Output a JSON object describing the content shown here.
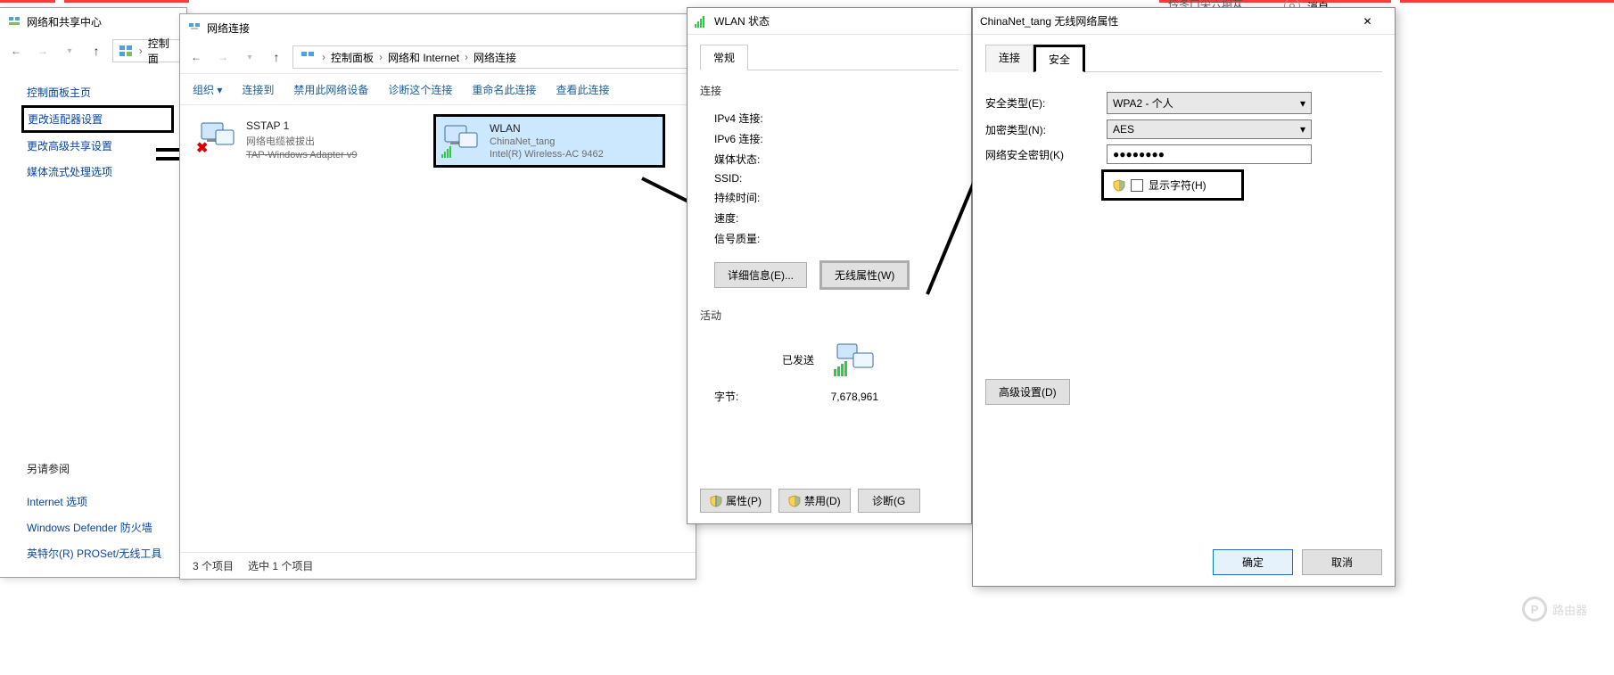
{
  "top_bar": {
    "msg_fragment_left": "—",
    "msg_fragment_right": "消自",
    "partial_text": "仱冬口尖六坰苁"
  },
  "win1": {
    "title": "网络和共享中心",
    "breadcrumb1": "控制面",
    "sidebar": {
      "home": "控制面板主页",
      "adapter": "更改适配器设置",
      "advanced": "更改高级共享设置",
      "media": "媒体流式处理选项",
      "see_also": "另请参阅",
      "internet_options": "Internet 选项",
      "defender": "Windows Defender 防火墙",
      "intel": "英特尔(R) PROSet/无线工具"
    }
  },
  "win2": {
    "title": "网络连接",
    "breadcrumb": [
      "控制面板",
      "网络和 Internet",
      "网络连接"
    ],
    "cmds": {
      "org": "组织",
      "connect": "连接到",
      "disable": "禁用此网络设备",
      "diagnose": "诊断这个连接",
      "rename": "重命名此连接",
      "view": "查看此连接"
    },
    "items": {
      "sstap": {
        "name": "SSTAP 1",
        "line2": "网络电缆被拔出",
        "line3": "TAP-Windows Adapter v9"
      },
      "wlan": {
        "name": "WLAN",
        "line2": "ChinaNet_tang",
        "line3": "Intel(R) Wireless-AC 9462"
      }
    },
    "status_left": "3 个项目",
    "status_right": "选中 1 个项目"
  },
  "wlan_status": {
    "title": "WLAN 状态",
    "tab_general": "常规",
    "section_connection": "连接",
    "rows": {
      "ipv4": "IPv4 连接:",
      "ipv6": "IPv6 连接:",
      "media": "媒体状态:",
      "ssid": "SSID:",
      "duration": "持续时间:",
      "speed": "速度:",
      "signal": "信号质量:"
    },
    "btn_details": "详细信息(E)...",
    "btn_wireless": "无线属性(W)",
    "section_activity": "活动",
    "sent": "已发送",
    "row_bytes": "字节:",
    "bytes_sent": "7,678,961",
    "btn_properties": "属性(P)",
    "btn_disable": "禁用(D)",
    "btn_diag": "诊断(G"
  },
  "wlan_props": {
    "title": "ChinaNet_tang 无线网络属性",
    "tab_connection": "连接",
    "tab_security": "安全",
    "lbl_sec_type": "安全类型(E):",
    "val_sec_type": "WPA2 - 个人",
    "lbl_enc_type": "加密类型(N):",
    "val_enc_type": "AES",
    "lbl_key": "网络安全密钥(K)",
    "val_key": "●●●●●●●●",
    "chk_show": "显示字符(H)",
    "btn_advanced": "高级设置(D)",
    "btn_ok": "确定",
    "btn_cancel": "取消"
  },
  "watermark": "路由器"
}
